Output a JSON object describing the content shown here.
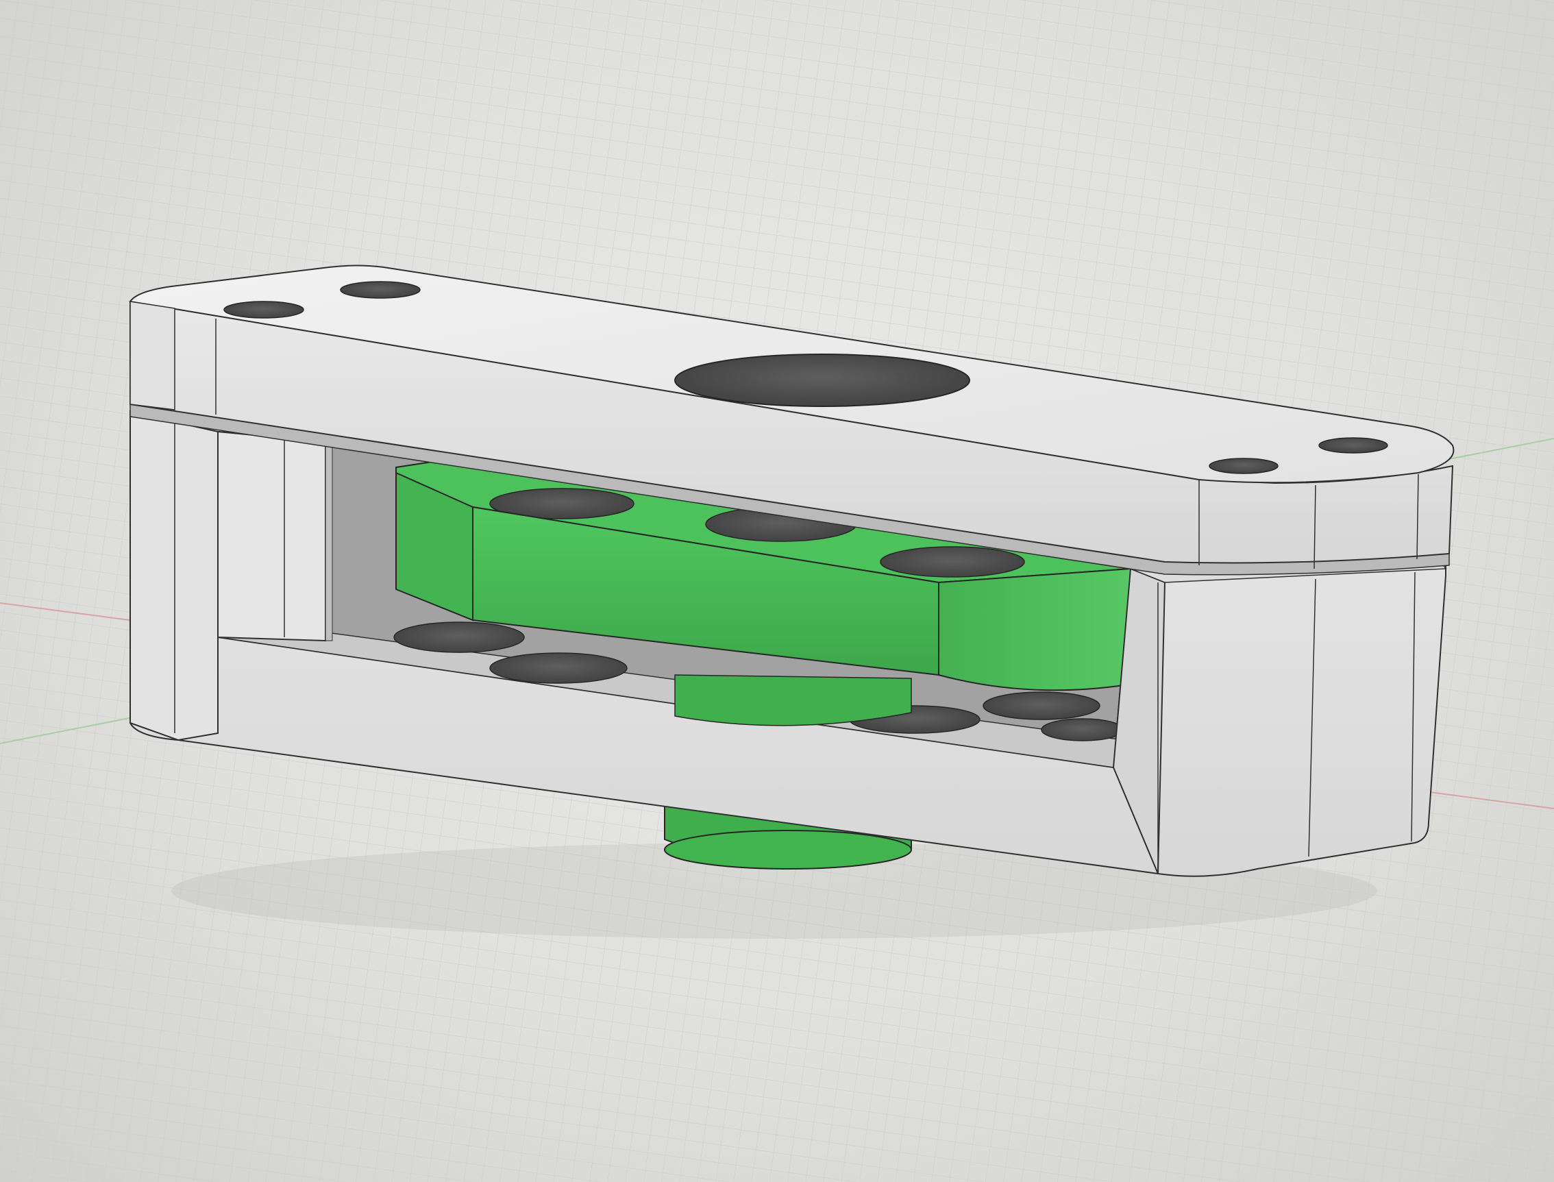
{
  "viewport": {
    "background": "#e4e4e2",
    "grid_color": "#c8c8c6",
    "axis_x_color": "#d9a6a6",
    "axis_y_color": "#a8d0a4"
  },
  "model": {
    "housing_color": "#e8e8e8",
    "housing_shade": "#cfcfcf",
    "edge_color": "#2a2a2a",
    "rotor_color": "#3fbf50",
    "rotor_shade": "#2f9c3e",
    "hole_color": "#4a4a4a"
  }
}
